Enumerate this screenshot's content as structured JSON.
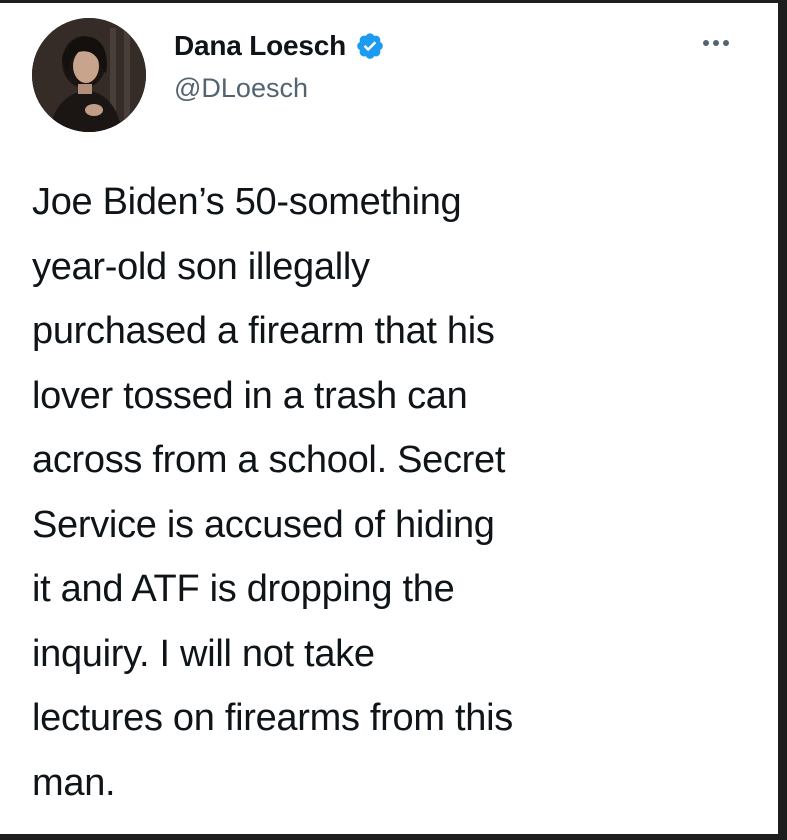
{
  "tweet": {
    "author": {
      "display_name": "Dana Loesch",
      "handle": "@DLoesch",
      "verified": true,
      "verified_icon": "verified-badge-icon",
      "avatar": "profile-photo"
    },
    "more_icon": "more-options-icon",
    "text_lines": [
      "Joe Biden’s 50-something",
      "year-old son illegally",
      "purchased a firearm that his",
      "lover tossed in a trash can",
      "across from a school. Secret",
      "Service is accused of hiding",
      "it and ATF is dropping the",
      "inquiry. I will not take",
      "lectures on firearms from this",
      "man."
    ]
  },
  "colors": {
    "verified_blue": "#1d9bf0",
    "text_primary": "#0f1419",
    "text_secondary": "#536471",
    "frame_border": "#1e1e1e"
  }
}
